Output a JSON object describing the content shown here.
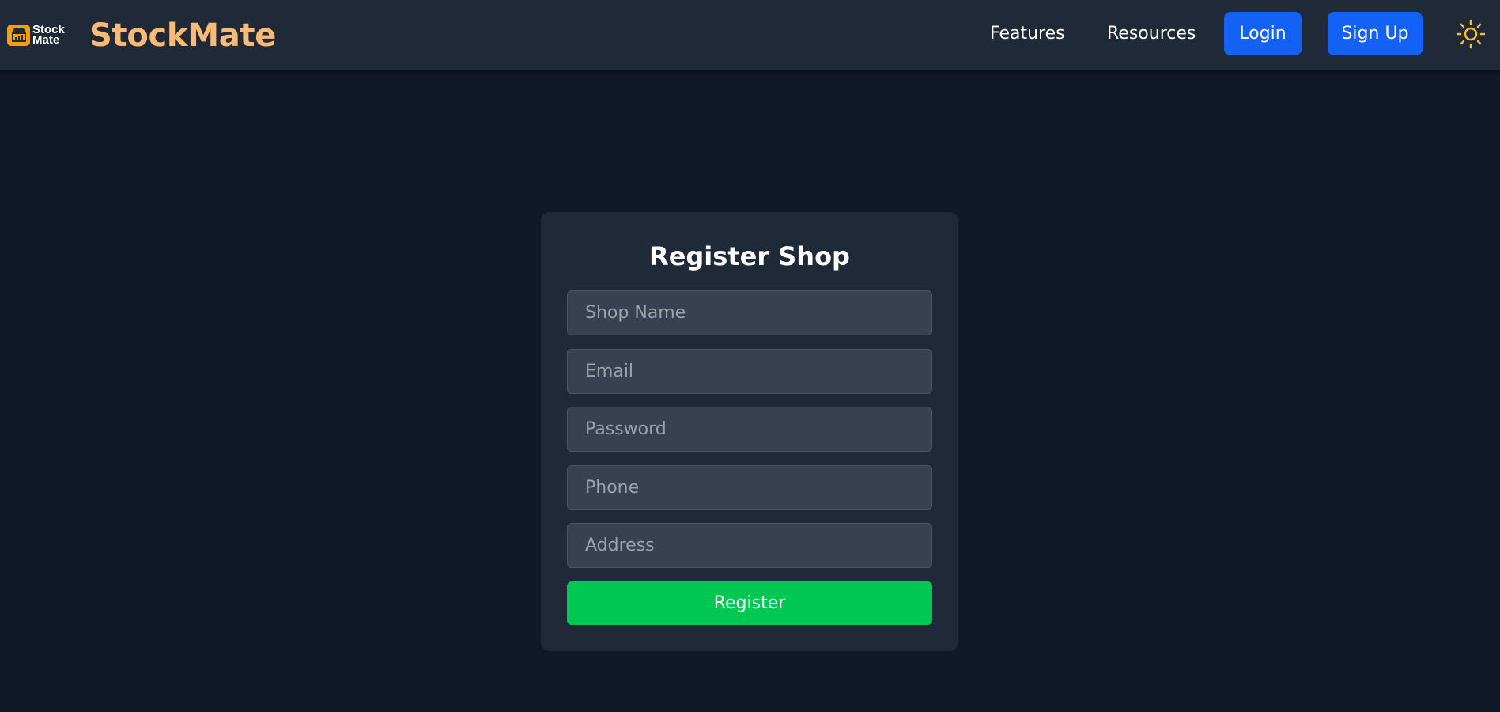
{
  "logo": {
    "icon": "shop-chart-icon",
    "text_line1": "Stock",
    "text_line2": "Mate",
    "badge_color": "#f59e0b"
  },
  "navbar": {
    "brand": "StockMate",
    "brand_color": "#fdba74",
    "links": [
      {
        "label": "Features"
      },
      {
        "label": "Resources"
      }
    ],
    "login_label": "Login",
    "signup_label": "Sign Up",
    "button_color": "#1461f5",
    "theme_icon": "sun-icon",
    "theme_icon_color": "#fbbf24"
  },
  "form": {
    "title": "Register Shop",
    "fields": [
      {
        "placeholder": "Shop Name",
        "value": ""
      },
      {
        "placeholder": "Email",
        "value": ""
      },
      {
        "placeholder": "Password",
        "value": ""
      },
      {
        "placeholder": "Phone",
        "value": ""
      },
      {
        "placeholder": "Address",
        "value": ""
      }
    ],
    "submit_label": "Register",
    "submit_color": "#00c853"
  },
  "colors": {
    "page_background": "#111827",
    "navbar_background": "#1f2937",
    "card_background": "#1f2937",
    "field_background": "#374151"
  }
}
